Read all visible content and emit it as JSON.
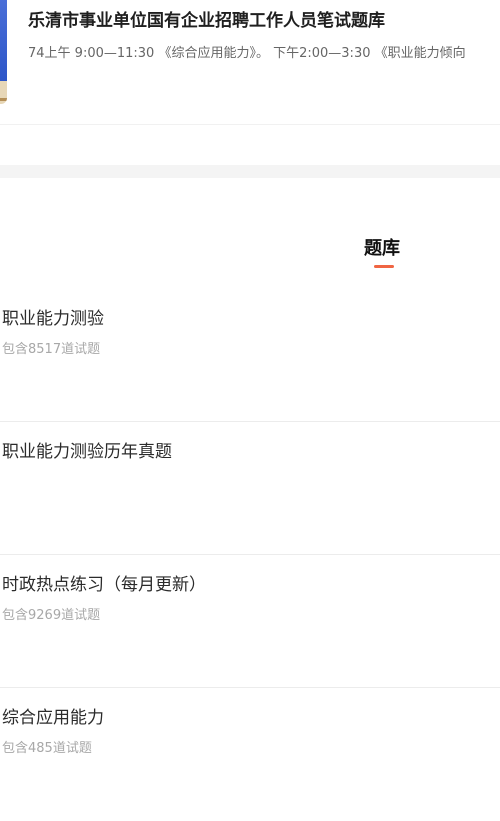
{
  "header": {
    "title": "乐清市事业单位国有企业招聘工作人员笔试题库",
    "subtitle": "74上午 9:00—11:30 《综合应用能力》。 下午2:00—3:30 《职业能力倾向"
  },
  "tabs": {
    "active_label": "题库"
  },
  "items": [
    {
      "title": "职业能力测验",
      "count": "包含8517道试题"
    },
    {
      "title": "职业能力测验历年真题",
      "count": ""
    },
    {
      "title": "时政热点练习（每月更新）",
      "count": "包含9269道试题"
    },
    {
      "title": "综合应用能力",
      "count": "包含485道试题"
    }
  ],
  "colors": {
    "accent": "#f06543",
    "divider": "#ececec",
    "muted_text": "#a8a8a8"
  }
}
